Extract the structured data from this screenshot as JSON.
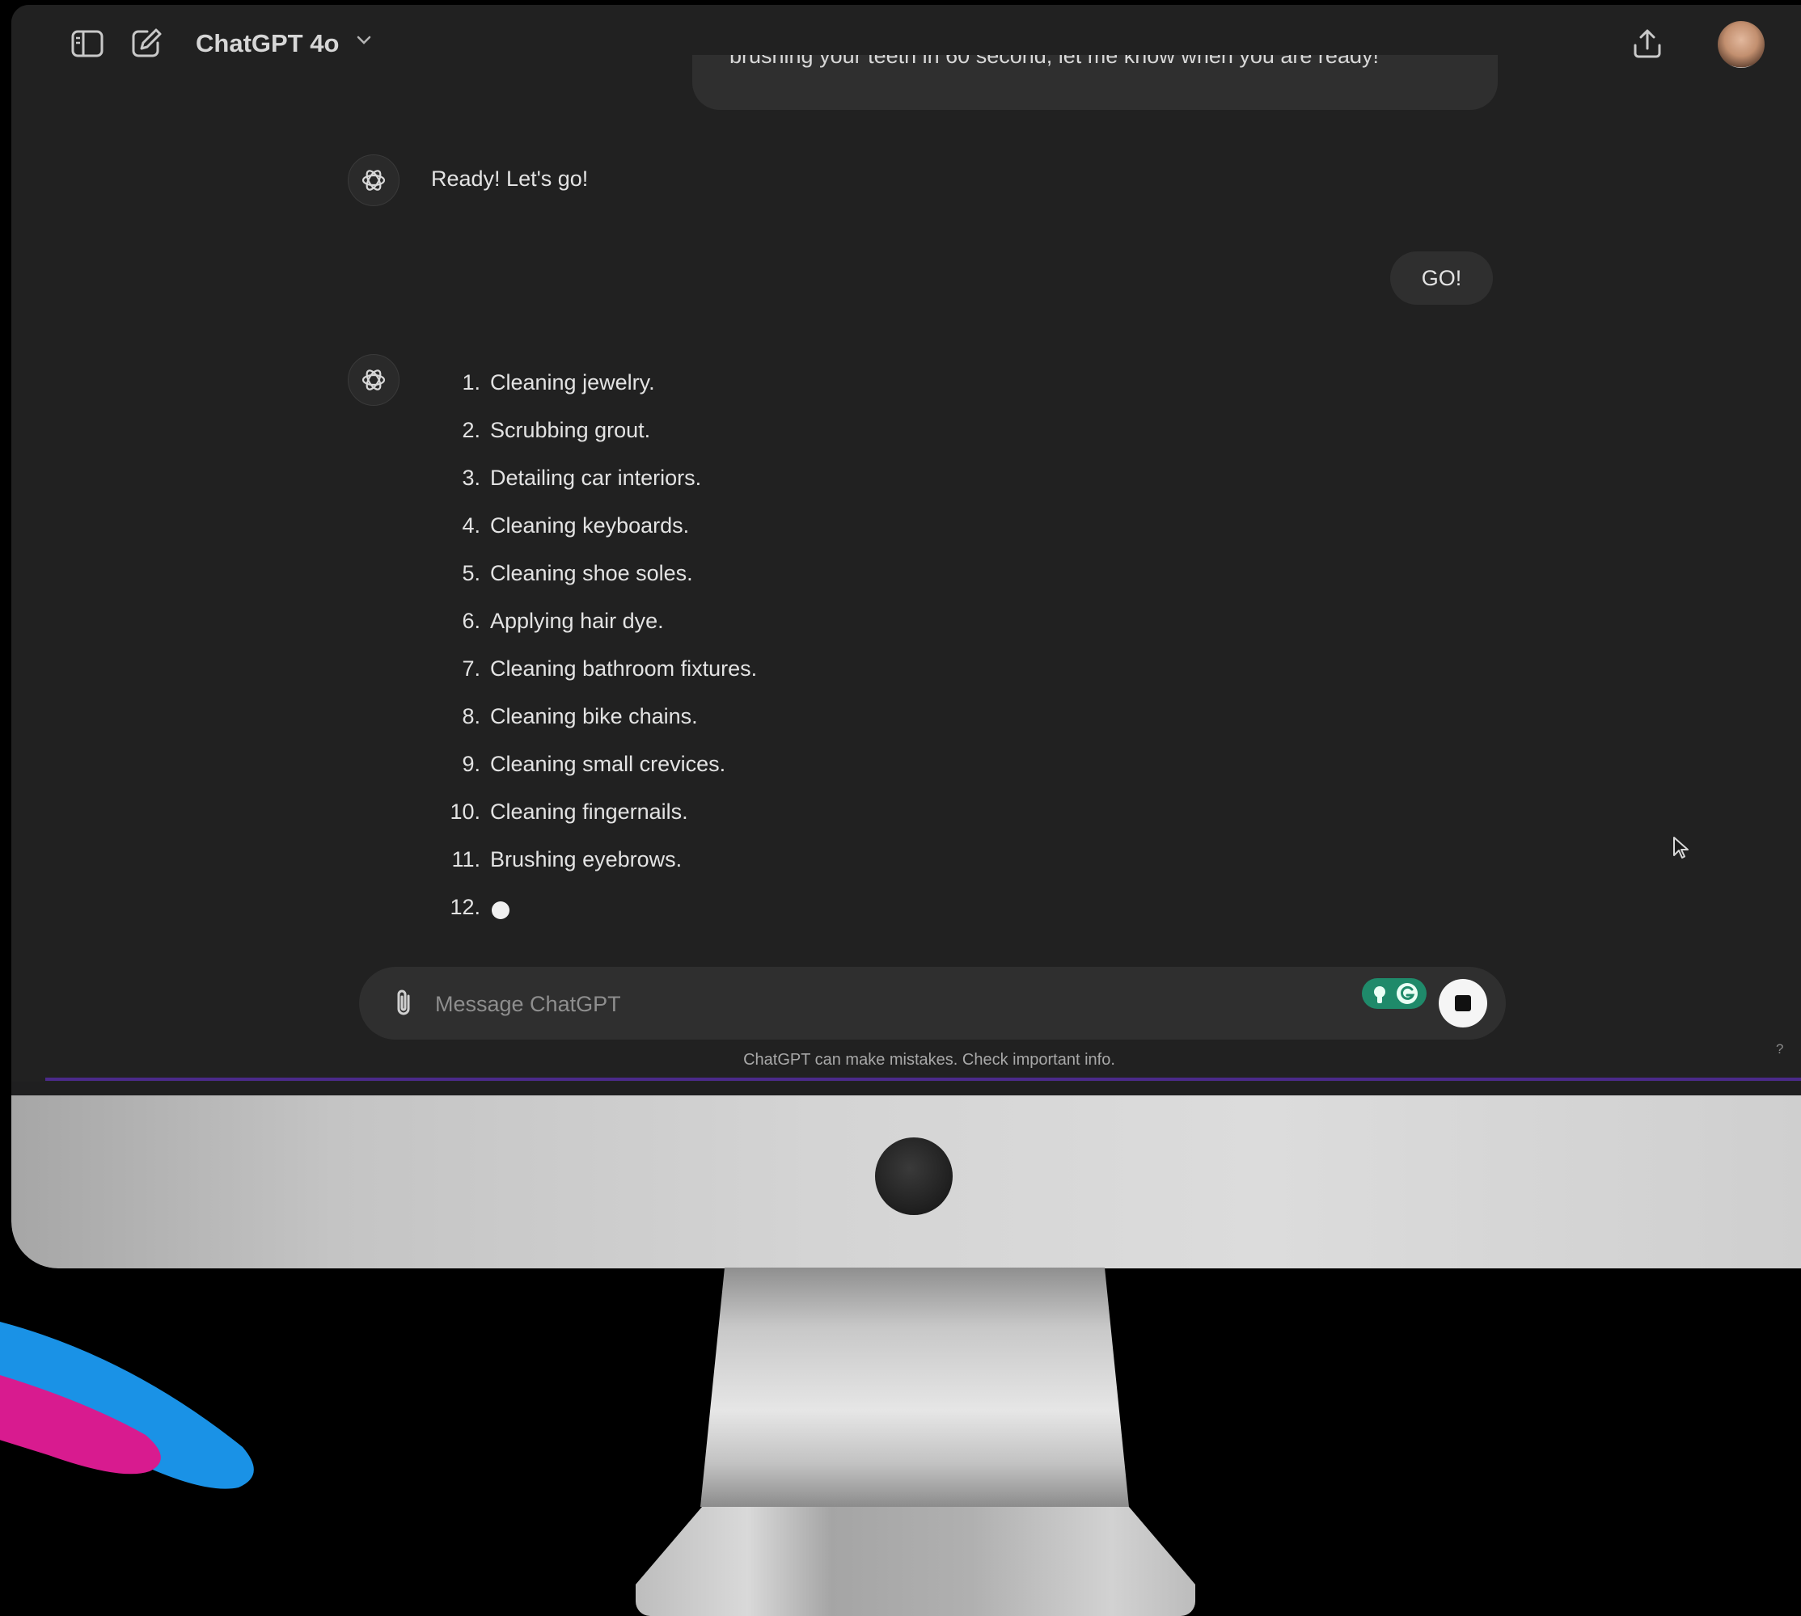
{
  "header": {
    "model_title": "ChatGPT 4o",
    "icons": [
      "sidebar-toggle-icon",
      "new-chat-icon",
      "chevron-down-icon",
      "share-icon",
      "avatar"
    ]
  },
  "conversation": {
    "user_message_top": "brushing your teeth in 60 second, let me know when you are ready!",
    "assistant_reply_1": "Ready! Let's go!",
    "user_message_2": "GO!",
    "assistant_list": [
      {
        "num": "1.",
        "text": "Cleaning jewelry."
      },
      {
        "num": "2.",
        "text": "Scrubbing grout."
      },
      {
        "num": "3.",
        "text": "Detailing car interiors."
      },
      {
        "num": "4.",
        "text": "Cleaning keyboards."
      },
      {
        "num": "5.",
        "text": "Cleaning shoe soles."
      },
      {
        "num": "6.",
        "text": "Applying hair dye."
      },
      {
        "num": "7.",
        "text": "Cleaning bathroom fixtures."
      },
      {
        "num": "8.",
        "text": "Cleaning bike chains."
      },
      {
        "num": "9.",
        "text": "Cleaning small crevices."
      },
      {
        "num": "10.",
        "text": "Cleaning fingernails."
      },
      {
        "num": "11.",
        "text": "Brushing eyebrows."
      },
      {
        "num": "12.",
        "text": ""
      }
    ]
  },
  "composer": {
    "placeholder": "Message ChatGPT",
    "value": ""
  },
  "footer": {
    "disclaimer": "ChatGPT can make mistakes. Check important info.",
    "help": "?"
  },
  "colors": {
    "background": "#212121",
    "bubble": "#2f2f2f",
    "text": "#e3e3e3",
    "accent_line": "#4b2a8a",
    "grammarly": "#1f8a6a"
  }
}
